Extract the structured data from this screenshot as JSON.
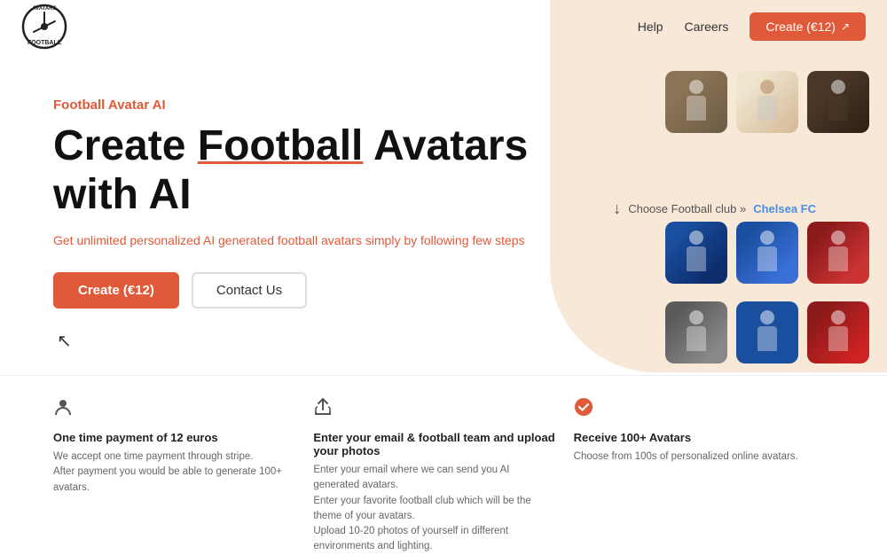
{
  "header": {
    "logo_alt": "Football Avatars",
    "nav": {
      "help_label": "Help",
      "careers_label": "Careers",
      "create_label": "Create (€12)"
    }
  },
  "hero": {
    "subtitle": "Football Avatar AI",
    "heading_line1": "Create Football Avatars",
    "heading_line2": "with AI",
    "heading_underline": "Football",
    "description": "Get unlimited personalized AI generated football avatars simply by following few steps",
    "create_button": "Create (€12)",
    "contact_button": "Contact Us",
    "club_prompt": "Choose Football club »",
    "club_name": "Chelsea FC"
  },
  "features": [
    {
      "icon": "person",
      "title": "One time payment of 12 euros",
      "desc_lines": [
        "We accept one time payment through stripe.",
        "After payment you would be able to generate 100+ avatars."
      ]
    },
    {
      "icon": "upload",
      "title": "Enter your email & football team and upload your photos",
      "desc_lines": [
        "Enter your email where we can send you AI generated avatars.",
        "Enter your favorite football club which will be the theme of your avatars.",
        "Upload 10-20 photos of yourself in different environments and lighting."
      ]
    },
    {
      "icon": "check",
      "title": "Receive 100+ Avatars",
      "desc_lines": [
        "Choose from 100s of personalized online avatars."
      ]
    }
  ],
  "avatars": {
    "row1": [
      "av1",
      "av2",
      "av3"
    ],
    "row2": [
      "av4",
      "av5",
      "av6"
    ],
    "row3": [
      "av7",
      "av8",
      "av9"
    ]
  }
}
